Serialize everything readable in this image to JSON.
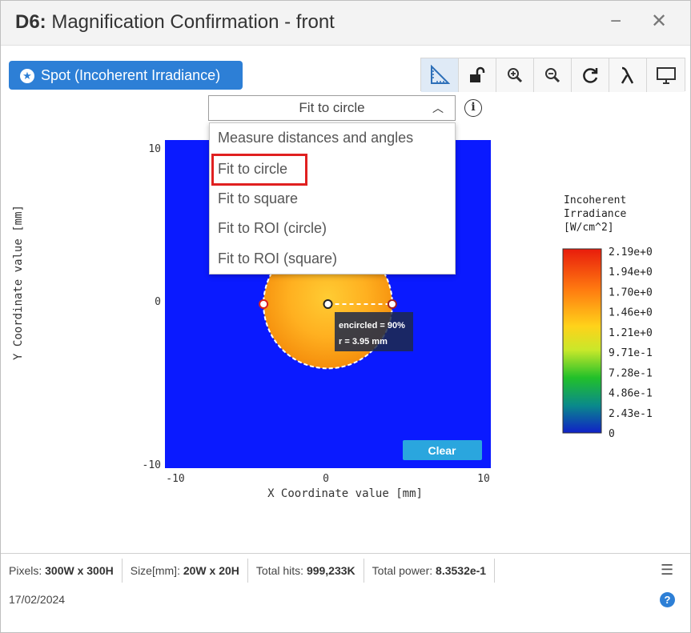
{
  "window": {
    "title_prefix": "D6:",
    "title": "Magnification Confirmation - front",
    "minimize": "−",
    "close": "✕"
  },
  "spot_button": {
    "label": "Spot (Incoherent Irradiance)"
  },
  "toolbar": {
    "tools": [
      "ruler-icon",
      "unlock-icon",
      "zoom-in-icon",
      "zoom-out-icon",
      "refresh-icon",
      "lambda-icon",
      "monitor-icon"
    ]
  },
  "fit_select": {
    "selected": "Fit to circle",
    "options": [
      "Measure distances and angles",
      "Fit to circle",
      "Fit to square",
      "Fit to ROI (circle)",
      "Fit to ROI (square)"
    ]
  },
  "plot": {
    "xlabel": "X Coordinate value [mm]",
    "ylabel": "Y Coordinate value [mm]",
    "x_ticks": [
      "-10",
      "0",
      "10"
    ],
    "y_ticks": [
      "10",
      "0",
      "-10"
    ],
    "xlim": [
      -10,
      10
    ],
    "ylim": [
      -10,
      10
    ],
    "background_color": "#0a1aff",
    "spot": {
      "center_x": 0,
      "center_y": 0,
      "radius": 3.95
    },
    "annotation": {
      "line1": "encircled = 90%",
      "line2": "r = 3.95 mm"
    },
    "clear_label": "Clear"
  },
  "colorbar": {
    "title_lines": [
      "Incoherent",
      "Irradiance",
      "[W/cm^2]"
    ],
    "ticks": [
      "2.19e+0",
      "1.94e+0",
      "1.70e+0",
      "1.46e+0",
      "1.21e+0",
      "9.71e-1",
      "7.28e-1",
      "4.86e-1",
      "2.43e-1",
      "0"
    ]
  },
  "status": {
    "pixels_label": "Pixels:",
    "pixels": "300W x 300H",
    "size_label": "Size[mm]:",
    "size": "20W x 20H",
    "hits_label": "Total hits:",
    "hits": "999,233K",
    "power_label": "Total power:",
    "power": "8.3532e-1",
    "date": "17/02/2024",
    "help": "?"
  }
}
